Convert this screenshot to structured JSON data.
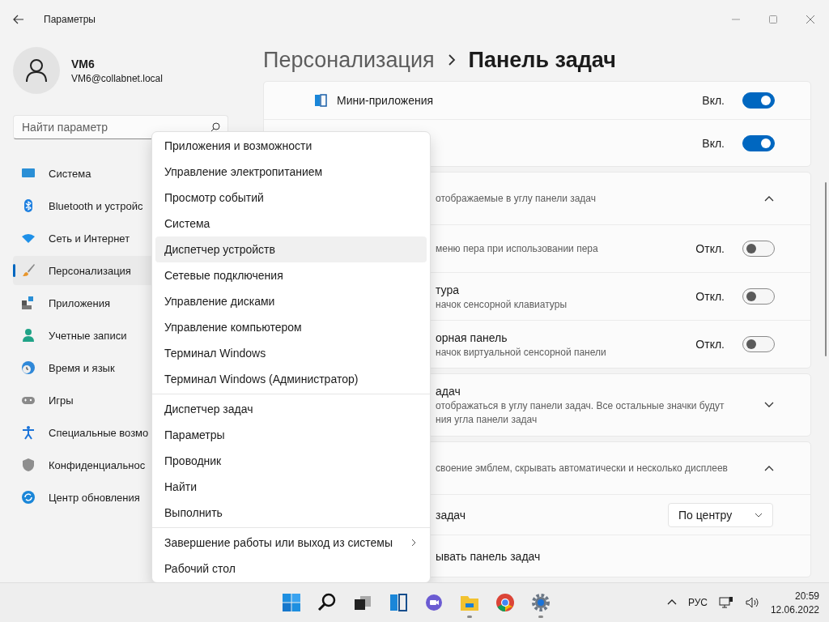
{
  "window": {
    "title": "Параметры"
  },
  "user": {
    "name": "VM6",
    "email": "VM6@collabnet.local"
  },
  "search": {
    "placeholder": "Найти параметр"
  },
  "nav": [
    {
      "label": "Система",
      "selected": false
    },
    {
      "label": "Bluetooth и устройс",
      "selected": false
    },
    {
      "label": "Сеть и Интернет",
      "selected": false
    },
    {
      "label": "Персонализация",
      "selected": true
    },
    {
      "label": "Приложения",
      "selected": false
    },
    {
      "label": "Учетные записи",
      "selected": false
    },
    {
      "label": "Время и язык",
      "selected": false
    },
    {
      "label": "Игры",
      "selected": false
    },
    {
      "label": "Специальные возмо",
      "selected": false
    },
    {
      "label": "Конфиденциальнос",
      "selected": false
    },
    {
      "label": "Центр обновления",
      "selected": false
    }
  ],
  "breadcrumb": [
    "Персонализация",
    "Панель задач"
  ],
  "cards": [
    {
      "rows": [
        {
          "kind": "icon-toggle",
          "title": "Мини-приложения",
          "state": "Вкл.",
          "on": true
        },
        {
          "kind": "toggle",
          "state": "Вкл.",
          "on": true
        }
      ]
    },
    {
      "rows": [
        {
          "kind": "header",
          "subtitle": "отображаемые в углу панели задач",
          "expanded": true
        },
        {
          "kind": "toggle",
          "subtitle": "меню пера при использовании пера",
          "state": "Откл.",
          "on": false
        },
        {
          "kind": "toggle",
          "title": "тура",
          "subtitle": "начок сенсорной клавиатуры",
          "state": "Откл.",
          "on": false
        },
        {
          "kind": "toggle",
          "title": "орная панель",
          "subtitle": "начок виртуальной сенсорной панели",
          "state": "Откл.",
          "on": false
        }
      ]
    },
    {
      "rows": [
        {
          "kind": "header",
          "title": "адач",
          "subtitle": "отображаться в углу панели задач. Все остальные значки будут",
          "subtitle2": "ния угла панели задач",
          "expanded": false
        }
      ]
    },
    {
      "rows": [
        {
          "kind": "header",
          "subtitle": "своение эмблем, скрывать автоматически и несколько дисплеев",
          "expanded": true
        },
        {
          "kind": "dropdown",
          "title": "задач",
          "value": "По центру"
        },
        {
          "kind": "plain",
          "title": "ывать панель задач"
        }
      ]
    }
  ],
  "context_menu": [
    [
      {
        "label": "Приложения и возможности",
        "selected": false
      },
      {
        "label": "Управление электропитанием",
        "selected": false
      },
      {
        "label": "Просмотр событий",
        "selected": false
      },
      {
        "label": "Система",
        "selected": false
      },
      {
        "label": "Диспетчер устройств",
        "selected": true
      },
      {
        "label": "Сетевые подключения",
        "selected": false
      },
      {
        "label": "Управление дисками",
        "selected": false
      },
      {
        "label": "Управление компьютером",
        "selected": false
      },
      {
        "label": "Терминал Windows",
        "selected": false
      },
      {
        "label": "Терминал Windows (Администратор)",
        "selected": false
      }
    ],
    [
      {
        "label": "Диспетчер задач",
        "selected": false
      },
      {
        "label": "Параметры",
        "selected": false
      },
      {
        "label": "Проводник",
        "selected": false
      },
      {
        "label": "Найти",
        "selected": false
      },
      {
        "label": "Выполнить",
        "selected": false
      }
    ],
    [
      {
        "label": "Завершение работы или выход из системы",
        "selected": false,
        "submenu": true
      },
      {
        "label": "Рабочий стол",
        "selected": false
      }
    ]
  ],
  "taskbar": {
    "language": "РУС",
    "time": "20:59",
    "date": "12.06.2022"
  }
}
